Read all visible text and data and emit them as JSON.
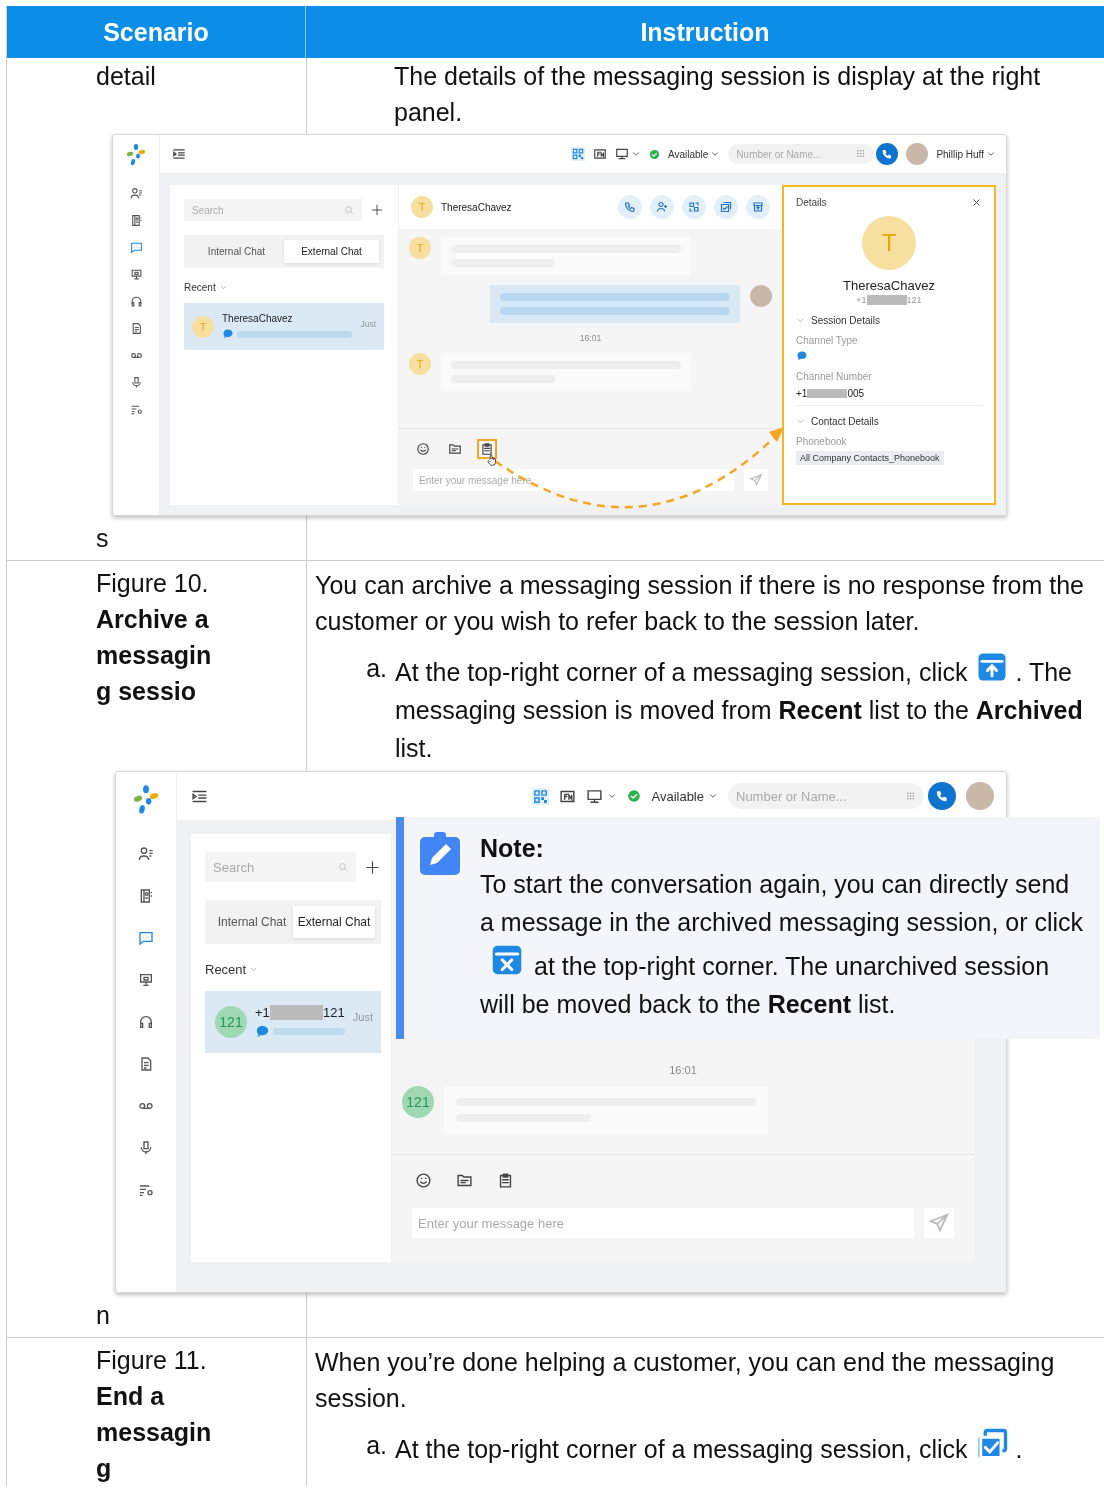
{
  "table": {
    "columns": [
      {
        "label": "Scenario"
      },
      {
        "label": "Instruction"
      }
    ],
    "rows": [
      {
        "scenario_top": "detail",
        "scenario_bottom": "s",
        "instruction": [
          {
            "kind": "continuation",
            "text": "The details of the messaging session is display at the right panel."
          }
        ],
        "screenshot": {
          "pointer_arrow": true,
          "app_bar": {
            "status": "Available",
            "search_placeholder": "Number or Name...",
            "user_name": "Phillip Huff"
          },
          "nav": [
            {
              "kind": "contacts",
              "selected": false
            },
            {
              "kind": "phonebook",
              "selected": false
            },
            {
              "kind": "chat",
              "selected": true
            },
            {
              "kind": "monitor",
              "selected": false
            },
            {
              "kind": "headset",
              "selected": false
            },
            {
              "kind": "report",
              "selected": false
            },
            {
              "kind": "voicemail",
              "selected": false
            },
            {
              "kind": "mic",
              "selected": false
            },
            {
              "kind": "settings",
              "selected": false
            }
          ],
          "list": {
            "search_placeholder": "Search",
            "tabs": [
              {
                "label": "Internal Chat",
                "selected": false
              },
              {
                "label": "External Chat",
                "selected": true
              }
            ],
            "section": "Recent",
            "sessions": [
              {
                "avatar": "T",
                "name": "TheresaChavez",
                "time": "Just",
                "selected": true
              }
            ]
          },
          "chat": {
            "avatar": "T",
            "name": "TheresaChavez",
            "actions": [
              {
                "kind": "call",
                "highlighted": false
              },
              {
                "kind": "add-contact",
                "highlighted": false
              },
              {
                "kind": "transfer",
                "highlighted": false
              },
              {
                "kind": "end",
                "highlighted": false
              },
              {
                "kind": "archive",
                "highlighted": false
              }
            ],
            "messages": [
              {
                "kind": "in",
                "avatar": "T"
              },
              {
                "kind": "out"
              },
              {
                "kind": "time",
                "text": "16:01"
              },
              {
                "kind": "in",
                "avatar": "T"
              }
            ],
            "tools": [
              {
                "kind": "emoji",
                "highlighted": false
              },
              {
                "kind": "folder",
                "highlighted": false
              },
              {
                "kind": "notes",
                "highlighted": true
              }
            ],
            "input_placeholder": "Enter your message here"
          },
          "details": {
            "title": "Details",
            "highlighted": true,
            "avatar": "T",
            "name": "TheresaChavez",
            "number_prefix": "+1",
            "number_suffix": "121",
            "sections": [
              {
                "title": "Session Details",
                "expanded": true,
                "fields": [
                  {
                    "kind": "sms",
                    "label": "Channel Type"
                  },
                  {
                    "kind": "number",
                    "label": "Channel Number",
                    "prefix": "+1",
                    "suffix": "005"
                  }
                ]
              },
              {
                "title": "Contact Details",
                "expanded": true,
                "fields": [
                  {
                    "kind": "tag",
                    "label": "Phonebook",
                    "value": "All Company Contacts_Phonebook"
                  }
                ]
              }
            ]
          }
        }
      },
      {
        "scenario_top": "Figure 10. **Archive a messagin g sessio**",
        "scenario_bottom": "n",
        "instruction": [
          {
            "kind": "paragraph",
            "text": "You can archive a messaging session if there is no response from the customer or you wish to refer back to the session later."
          },
          {
            "kind": "archive-step",
            "marker": "a.",
            "before": "At the top-right corner of a messaging session, click",
            "after": ". The messaging session is moved from **Recent** list to the **Archived** list."
          }
        ],
        "screenshot": {
          "app_bar": {
            "status": "Available",
            "search_placeholder": "Number or Name..."
          },
          "nav": [
            {
              "kind": "contacts",
              "selected": false
            },
            {
              "kind": "phonebook",
              "selected": false
            },
            {
              "kind": "chat",
              "selected": true
            },
            {
              "kind": "monitor",
              "selected": false
            },
            {
              "kind": "headset",
              "selected": false
            },
            {
              "kind": "report",
              "selected": false
            },
            {
              "kind": "voicemail",
              "selected": false
            },
            {
              "kind": "mic",
              "selected": false
            },
            {
              "kind": "settings",
              "selected": false
            }
          ],
          "list": {
            "search_placeholder": "Search",
            "tabs": [
              {
                "label": "Internal Chat",
                "selected": false
              },
              {
                "label": "External Chat",
                "selected": true
              }
            ],
            "section": "Recent",
            "sessions": [
              {
                "avatar": "121",
                "number_prefix": "+1",
                "number_suffix": "121",
                "time": "Just",
                "selected": true
              }
            ]
          },
          "chat": {
            "messages": [
              {
                "kind": "time",
                "text": "16:01"
              },
              {
                "kind": "in",
                "avatar": "121"
              }
            ],
            "tools": [
              {
                "kind": "emoji",
                "highlighted": false
              },
              {
                "kind": "folder",
                "highlighted": false
              },
              {
                "kind": "notes",
                "highlighted": false
              }
            ],
            "input_placeholder": "Enter your message here"
          }
        },
        "note": {
          "title": "Note:",
          "before": "To start the conversation again, you can directly send a message in the archived messaging session, or click",
          "after": "at the top-right corner. The unarchived session will be moved back to the **Recent** list."
        }
      },
      {
        "scenario_top": "Figure 11. **End a messagin g**",
        "instruction": [
          {
            "kind": "paragraph",
            "text": "When you’re done helping a customer, you can end the messaging session."
          },
          {
            "kind": "end-step",
            "marker": "a.",
            "before": "At the top-right corner of a messaging session, click",
            "after": "."
          }
        ]
      }
    ]
  }
}
